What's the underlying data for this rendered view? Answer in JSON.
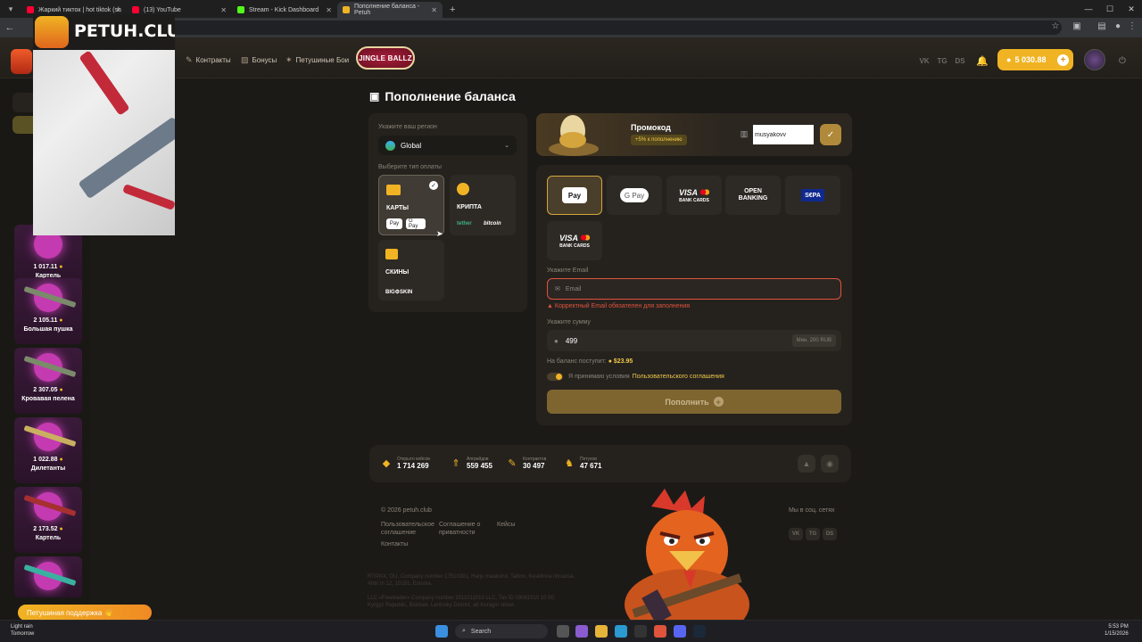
{
  "browser": {
    "tabs": [
      {
        "title": "Жаркий тикток | hot tiktok (sh",
        "color": "#ff0033"
      },
      {
        "title": "(13) YouTube",
        "color": "#ff0033"
      },
      {
        "title": "Stream - Kick Dashboard",
        "color": "#53fc18"
      },
      {
        "title": "Пополнение баланса - Petuh",
        "color": "#f0b323"
      }
    ]
  },
  "overlay": {
    "title": "PETUH.CLUB"
  },
  "header": {
    "nav": [
      "Контракты",
      "Бонусы",
      "Петушиные Бои"
    ],
    "event": "JINGLE BALLZ",
    "balance": "5 030.88",
    "social": [
      "VK",
      "TG",
      "DS"
    ]
  },
  "sidebar": {
    "cases": [
      {
        "price": "1 017.11",
        "name": "Картель"
      },
      {
        "price": "2 105.11",
        "name": "Большая пушка"
      },
      {
        "price": "2 307.05",
        "name": "Кровавая пелена"
      },
      {
        "price": "1 022.88",
        "name": "Дилетанты"
      },
      {
        "price": "2 173.52",
        "name": "Картель"
      }
    ],
    "support": "Петушиная поддержка 👋"
  },
  "page": {
    "title": "Пополнение баланса"
  },
  "left_panel": {
    "region_label": "Укажите ваш регион",
    "region": "Global",
    "payment_label": "Выберите тип оплаты",
    "types": [
      {
        "label": "КАРТЫ"
      },
      {
        "label": "КРИПТА"
      },
      {
        "label": "СКИНЫ"
      }
    ],
    "mini": {
      "apple": "Pay",
      "google": "G Pay",
      "tether": "tether",
      "bitcoin": "bitcoin",
      "skin": "BIG⚙SKIN"
    }
  },
  "promo": {
    "title": "Промокод",
    "badge": "+5% к пополнению",
    "value": "musyakovv"
  },
  "methods": {
    "apple": "Pay",
    "gpay": "G Pay",
    "visa": "VISA",
    "bank_cards": "BANK CARDS",
    "open_banking_1": "OPEN",
    "open_banking_2": "BANKING",
    "sepa": "S€PA"
  },
  "form": {
    "email_label": "Укажите Email",
    "email_placeholder": "Email",
    "email_error": "Корректный Email обязателен для заполнения",
    "amount_label": "Укажите сумму",
    "amount": "499",
    "min": "Мин. 200 RUB",
    "credit_label": "На баланс поступит:",
    "credit_value": "$23.95",
    "agree_text": "Я принимаю условия",
    "agree_link": "Пользовательского соглашения",
    "submit": "Пополнить"
  },
  "stats": [
    {
      "label": "Открыто кейсов",
      "value": "1 714 269"
    },
    {
      "label": "Апгрейдов",
      "value": "559 455"
    },
    {
      "label": "Контрактов",
      "value": "30 497"
    },
    {
      "label": "Петухов",
      "value": "47 671"
    }
  ],
  "footer": {
    "copyright": "© 2026 petuh.club",
    "link1a": "Пользовательское",
    "link1b": "соглашение",
    "link2a": "Соглашение о",
    "link2b": "приватности",
    "link3": "Кейсы",
    "link4": "Контакты",
    "social_title": "Мы в соц. сетях",
    "legal1": "RTIPAX, OU, Company number 17510301, Harju maakond, Tallinn, Kesklinna linnaosa,",
    "legal2": "Ahtri tn 12, 10151, Estonia.",
    "legal3": "LLC «Freetrader» Company number 3011011010 LLC, Tax ID 09061910 10 00,",
    "legal4": "Kyrgyz Republic, Bishkek, Leninsky District, ab Kuragin street."
  },
  "taskbar": {
    "weather1": "Light rain",
    "weather2": "Tomorrow",
    "search": "Search",
    "time": "5:53 PM",
    "date": "1/15/2026"
  }
}
